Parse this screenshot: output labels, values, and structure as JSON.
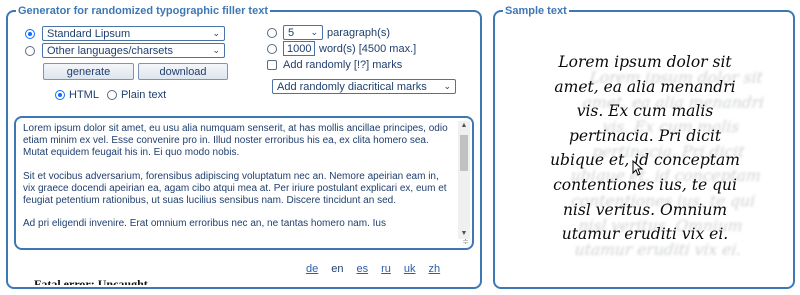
{
  "generator": {
    "title": "Generator for randomized typographic filler text",
    "source_options": [
      {
        "selected": true,
        "value": "Standard Lipsum"
      },
      {
        "selected": false,
        "value": "Other languages/charsets"
      }
    ],
    "length_options": {
      "paragraphs": {
        "selected": false,
        "value": "5",
        "label": "paragraph(s)"
      },
      "words": {
        "selected": false,
        "value": "1000",
        "label": "word(s) [4500 max.]"
      }
    },
    "random_marks": {
      "checked": false,
      "label": "Add randomly [!?] marks"
    },
    "diacritics_select": "Add randomly diacritical marks",
    "buttons": {
      "generate": "generate",
      "download": "download"
    },
    "format": [
      {
        "selected": true,
        "label": "HTML"
      },
      {
        "selected": false,
        "label": "Plain text"
      }
    ],
    "output_paragraphs": [
      "Lorem ipsum dolor sit amet, eu usu alia numquam senserit, at has mollis ancillae principes, odio etiam minim ex vel. Esse convenire pro in. Illud noster erroribus his ea, ex clita homero sea. Mutat equidem feugait his in. Ei quo modo nobis.",
      "Sit et vocibus adversarium, forensibus adipiscing voluptatum nec an. Nemore apeirian eam in, vix graece docendi apeirian ea, agam cibo atqui mea at. Per iriure postulant explicari ex, eum et feugiat petentium rationibus, ut suas lucilius sensibus nam. Discere tincidunt an sed.",
      "Ad pri eligendi invenire. Erat omnium erroribus nec an, ne tantas homero nam. Ius"
    ],
    "languages": [
      {
        "code": "de",
        "link": true
      },
      {
        "code": "en",
        "link": false
      },
      {
        "code": "es",
        "link": true
      },
      {
        "code": "ru",
        "link": true
      },
      {
        "code": "uk",
        "link": true
      },
      {
        "code": "zh",
        "link": true
      }
    ],
    "clipped_text": "Fatal error: Uncaught"
  },
  "sample": {
    "title": "Sample text",
    "lines": [
      "Lorem ipsum dolor sit",
      "amet, ea alia menandri",
      "vis. Ex cum malis",
      "pertinacia. Pri dicit",
      "ubique et, id conceptam",
      "contentiones ius, te qui",
      "nisl veritus. Omnium",
      "utamur eruditi vix ei."
    ]
  },
  "colors": {
    "accent": "#3d78b5",
    "text": "#1f3f6e",
    "link": "#2a5db0"
  }
}
